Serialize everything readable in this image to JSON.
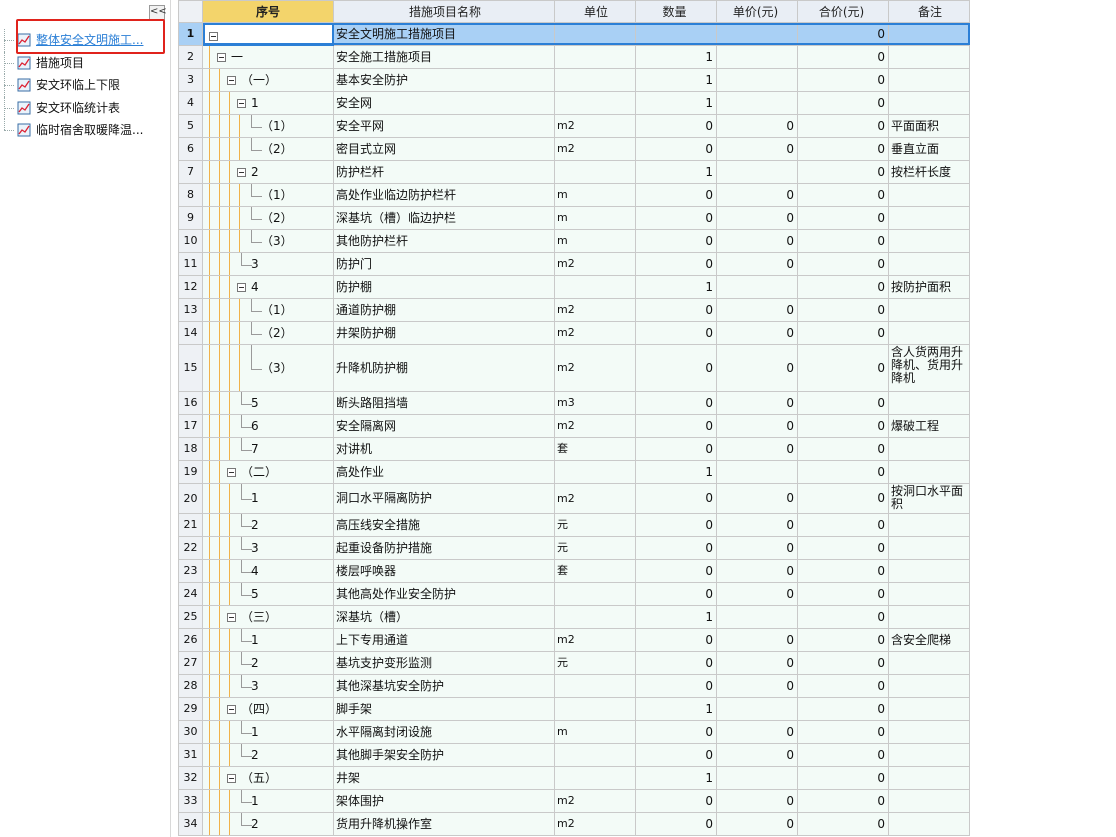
{
  "left_panel": {
    "collapse_glyph": "<<",
    "items": [
      {
        "label": "整体安全文明施工...",
        "icon": "sheet-chart-icon",
        "selected": true
      },
      {
        "label": "措施项目",
        "icon": "sheet-chart-icon",
        "selected": false
      },
      {
        "label": "安文环临上下限",
        "icon": "sheet-chart-icon",
        "selected": false
      },
      {
        "label": "安文环临统计表",
        "icon": "sheet-chart-icon",
        "selected": false
      },
      {
        "label": "临时宿舍取暖降温...",
        "icon": "sheet-chart-icon",
        "selected": false
      }
    ]
  },
  "table": {
    "columns": [
      "序号",
      "措施项目名称",
      "单位",
      "数量",
      "单价(元)",
      "合价(元)",
      "备注"
    ],
    "rows": [
      {
        "n": "1",
        "level": 0,
        "seq": "",
        "toggle": true,
        "name": "安全文明施工措施项目",
        "unit": "",
        "qty": "",
        "price": "",
        "total": "0",
        "note": ""
      },
      {
        "n": "2",
        "level": 1,
        "seq": "一",
        "toggle": true,
        "name": "安全施工措施项目",
        "unit": "",
        "qty": "1",
        "price": "",
        "total": "0",
        "note": ""
      },
      {
        "n": "3",
        "level": 2,
        "seq": "（一）",
        "toggle": true,
        "name": "基本安全防护",
        "unit": "",
        "qty": "1",
        "price": "",
        "total": "0",
        "note": ""
      },
      {
        "n": "4",
        "level": 3,
        "seq": "1",
        "toggle": true,
        "name": "安全网",
        "unit": "",
        "qty": "1",
        "price": "",
        "total": "0",
        "note": ""
      },
      {
        "n": "5",
        "level": 4,
        "seq": "（1）",
        "toggle": false,
        "name": "安全平网",
        "unit": "m2",
        "qty": "0",
        "price": "0",
        "total": "0",
        "note": "平面面积"
      },
      {
        "n": "6",
        "level": 4,
        "seq": "（2）",
        "toggle": false,
        "name": "密目式立网",
        "unit": "m2",
        "qty": "0",
        "price": "0",
        "total": "0",
        "note": "垂直立面"
      },
      {
        "n": "7",
        "level": 3,
        "seq": "2",
        "toggle": true,
        "name": "防护栏杆",
        "unit": "",
        "qty": "1",
        "price": "",
        "total": "0",
        "note": "按栏杆长度"
      },
      {
        "n": "8",
        "level": 4,
        "seq": "（1）",
        "toggle": false,
        "name": "高处作业临边防护栏杆",
        "unit": "m",
        "qty": "0",
        "price": "0",
        "total": "0",
        "note": ""
      },
      {
        "n": "9",
        "level": 4,
        "seq": "（2）",
        "toggle": false,
        "name": "深基坑（槽）临边护栏",
        "unit": "m",
        "qty": "0",
        "price": "0",
        "total": "0",
        "note": ""
      },
      {
        "n": "10",
        "level": 4,
        "seq": "（3）",
        "toggle": false,
        "name": "其他防护栏杆",
        "unit": "m",
        "qty": "0",
        "price": "0",
        "total": "0",
        "note": ""
      },
      {
        "n": "11",
        "level": 3,
        "seq": "3",
        "toggle": false,
        "name": "防护门",
        "unit": "m2",
        "qty": "0",
        "price": "0",
        "total": "0",
        "note": ""
      },
      {
        "n": "12",
        "level": 3,
        "seq": "4",
        "toggle": true,
        "name": "防护棚",
        "unit": "",
        "qty": "1",
        "price": "",
        "total": "0",
        "note": "按防护面积"
      },
      {
        "n": "13",
        "level": 4,
        "seq": "（1）",
        "toggle": false,
        "name": "通道防护棚",
        "unit": "m2",
        "qty": "0",
        "price": "0",
        "total": "0",
        "note": ""
      },
      {
        "n": "14",
        "level": 4,
        "seq": "（2）",
        "toggle": false,
        "name": "井架防护棚",
        "unit": "m2",
        "qty": "0",
        "price": "0",
        "total": "0",
        "note": ""
      },
      {
        "n": "15",
        "level": 4,
        "seq": "（3）",
        "toggle": false,
        "name": "升降机防护棚",
        "unit": "m2",
        "qty": "0",
        "price": "0",
        "total": "0",
        "note": "含人货两用升降机、货用升降机"
      },
      {
        "n": "16",
        "level": 3,
        "seq": "5",
        "toggle": false,
        "name": "断头路阻挡墙",
        "unit": "m3",
        "qty": "0",
        "price": "0",
        "total": "0",
        "note": ""
      },
      {
        "n": "17",
        "level": 3,
        "seq": "6",
        "toggle": false,
        "name": "安全隔离网",
        "unit": "m2",
        "qty": "0",
        "price": "0",
        "total": "0",
        "note": "爆破工程"
      },
      {
        "n": "18",
        "level": 3,
        "seq": "7",
        "toggle": false,
        "name": "对讲机",
        "unit": "套",
        "qty": "0",
        "price": "0",
        "total": "0",
        "note": ""
      },
      {
        "n": "19",
        "level": 2,
        "seq": "（二）",
        "toggle": true,
        "name": "高处作业",
        "unit": "",
        "qty": "1",
        "price": "",
        "total": "0",
        "note": ""
      },
      {
        "n": "20",
        "level": 3,
        "seq": "1",
        "toggle": false,
        "name": "洞口水平隔离防护",
        "unit": "m2",
        "qty": "0",
        "price": "0",
        "total": "0",
        "note": "按洞口水平面积"
      },
      {
        "n": "21",
        "level": 3,
        "seq": "2",
        "toggle": false,
        "name": "高压线安全措施",
        "unit": "元",
        "qty": "0",
        "price": "0",
        "total": "0",
        "note": ""
      },
      {
        "n": "22",
        "level": 3,
        "seq": "3",
        "toggle": false,
        "name": "起重设备防护措施",
        "unit": "元",
        "qty": "0",
        "price": "0",
        "total": "0",
        "note": ""
      },
      {
        "n": "23",
        "level": 3,
        "seq": "4",
        "toggle": false,
        "name": "楼层呼唤器",
        "unit": "套",
        "qty": "0",
        "price": "0",
        "total": "0",
        "note": ""
      },
      {
        "n": "24",
        "level": 3,
        "seq": "5",
        "toggle": false,
        "name": "其他高处作业安全防护",
        "unit": "",
        "qty": "0",
        "price": "0",
        "total": "0",
        "note": ""
      },
      {
        "n": "25",
        "level": 2,
        "seq": "（三）",
        "toggle": true,
        "name": "深基坑（槽）",
        "unit": "",
        "qty": "1",
        "price": "",
        "total": "0",
        "note": ""
      },
      {
        "n": "26",
        "level": 3,
        "seq": "1",
        "toggle": false,
        "name": "上下专用通道",
        "unit": "m2",
        "qty": "0",
        "price": "0",
        "total": "0",
        "note": "含安全爬梯"
      },
      {
        "n": "27",
        "level": 3,
        "seq": "2",
        "toggle": false,
        "name": "基坑支护变形监测",
        "unit": "元",
        "qty": "0",
        "price": "0",
        "total": "0",
        "note": ""
      },
      {
        "n": "28",
        "level": 3,
        "seq": "3",
        "toggle": false,
        "name": "其他深基坑安全防护",
        "unit": "",
        "qty": "0",
        "price": "0",
        "total": "0",
        "note": ""
      },
      {
        "n": "29",
        "level": 2,
        "seq": "（四）",
        "toggle": true,
        "name": "脚手架",
        "unit": "",
        "qty": "1",
        "price": "",
        "total": "0",
        "note": ""
      },
      {
        "n": "30",
        "level": 3,
        "seq": "1",
        "toggle": false,
        "name": "水平隔离封闭设施",
        "unit": "m",
        "qty": "0",
        "price": "0",
        "total": "0",
        "note": ""
      },
      {
        "n": "31",
        "level": 3,
        "seq": "2",
        "toggle": false,
        "name": "其他脚手架安全防护",
        "unit": "",
        "qty": "0",
        "price": "0",
        "total": "0",
        "note": ""
      },
      {
        "n": "32",
        "level": 2,
        "seq": "（五）",
        "toggle": true,
        "name": "井架",
        "unit": "",
        "qty": "1",
        "price": "",
        "total": "0",
        "note": ""
      },
      {
        "n": "33",
        "level": 3,
        "seq": "1",
        "toggle": false,
        "name": "架体围护",
        "unit": "m2",
        "qty": "0",
        "price": "0",
        "total": "0",
        "note": ""
      },
      {
        "n": "34",
        "level": 3,
        "seq": "2",
        "toggle": false,
        "name": "货用升降机操作室",
        "unit": "m2",
        "qty": "0",
        "price": "0",
        "total": "0",
        "note": ""
      }
    ]
  },
  "colors": {
    "selected_row": "#a9d0f5",
    "data_cell": "#f3fbf7",
    "header_seq": "#f3d46b",
    "highlight_box": "#e0231c",
    "nav_selected_text": "#2b7fd6"
  }
}
